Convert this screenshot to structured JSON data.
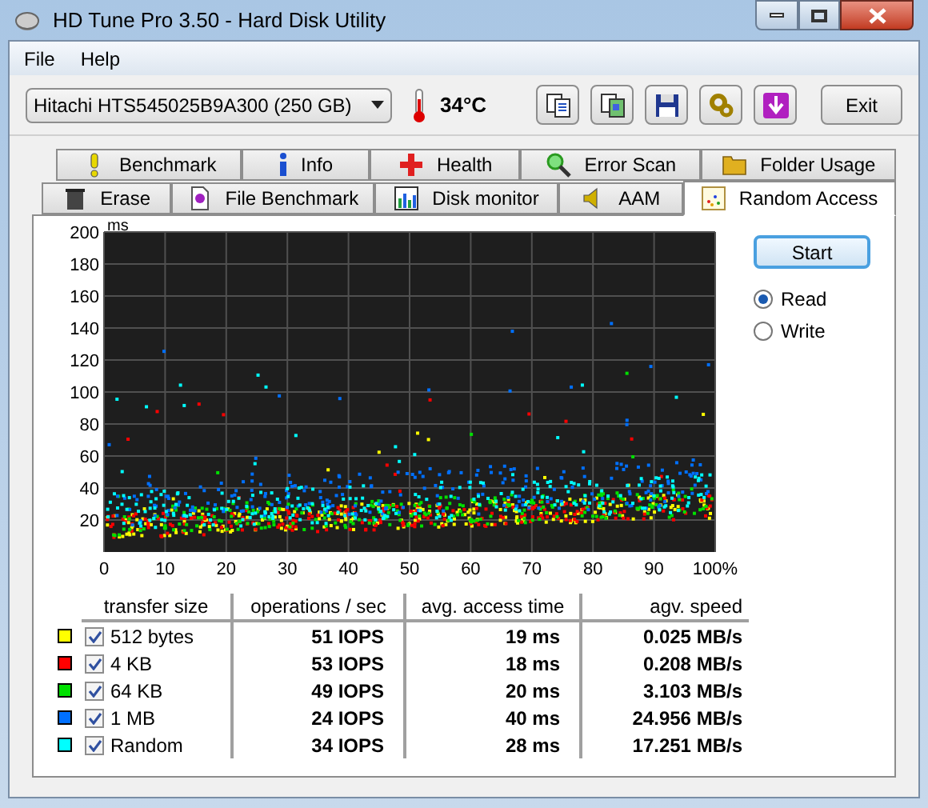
{
  "window": {
    "title": "HD Tune Pro 3.50 - Hard Disk Utility"
  },
  "menu": [
    "File",
    "Help"
  ],
  "drive_select": {
    "value": "Hitachi HTS545025B9A300 (250 GB)"
  },
  "temperature": "34°C",
  "exit_button": "Exit",
  "tabs_top": [
    {
      "label": "Benchmark",
      "selected": false
    },
    {
      "label": "Info",
      "selected": false
    },
    {
      "label": "Health",
      "selected": false
    },
    {
      "label": "Error Scan",
      "selected": false
    },
    {
      "label": "Folder Usage",
      "selected": false
    }
  ],
  "tabs_bottom": [
    {
      "label": "Erase",
      "selected": false
    },
    {
      "label": "File Benchmark",
      "selected": false
    },
    {
      "label": "Disk monitor",
      "selected": false
    },
    {
      "label": "AAM",
      "selected": false
    },
    {
      "label": "Random Access",
      "selected": true
    }
  ],
  "chart": {
    "unit": "ms",
    "y_labels": [
      "200",
      "180",
      "160",
      "140",
      "120",
      "100",
      "80",
      "60",
      "40",
      "20"
    ],
    "x_labels": [
      "0",
      "10",
      "20",
      "30",
      "40",
      "50",
      "60",
      "70",
      "80",
      "90",
      "100%"
    ]
  },
  "start_button": "Start",
  "modes": [
    {
      "label": "Read",
      "selected": true
    },
    {
      "label": "Write",
      "selected": false
    }
  ],
  "table": {
    "columns": [
      "transfer size",
      "operations / sec",
      "avg. access time",
      "agv. speed"
    ],
    "rows": [
      {
        "color": "#ffff00",
        "checked": true,
        "size": "512 bytes",
        "ops": "51 IOPS",
        "access": "19 ms",
        "speed": "0.025 MB/s"
      },
      {
        "color": "#ff0000",
        "checked": true,
        "size": "4 KB",
        "ops": "53 IOPS",
        "access": "18 ms",
        "speed": "0.208 MB/s"
      },
      {
        "color": "#00e000",
        "checked": true,
        "size": "64 KB",
        "ops": "49 IOPS",
        "access": "20 ms",
        "speed": "3.103 MB/s"
      },
      {
        "color": "#0070ff",
        "checked": true,
        "size": "1 MB",
        "ops": "24 IOPS",
        "access": "40 ms",
        "speed": "24.956 MB/s"
      },
      {
        "color": "#00ffff",
        "checked": true,
        "size": "Random",
        "ops": "34 IOPS",
        "access": "28 ms",
        "speed": "17.251 MB/s"
      }
    ]
  }
}
